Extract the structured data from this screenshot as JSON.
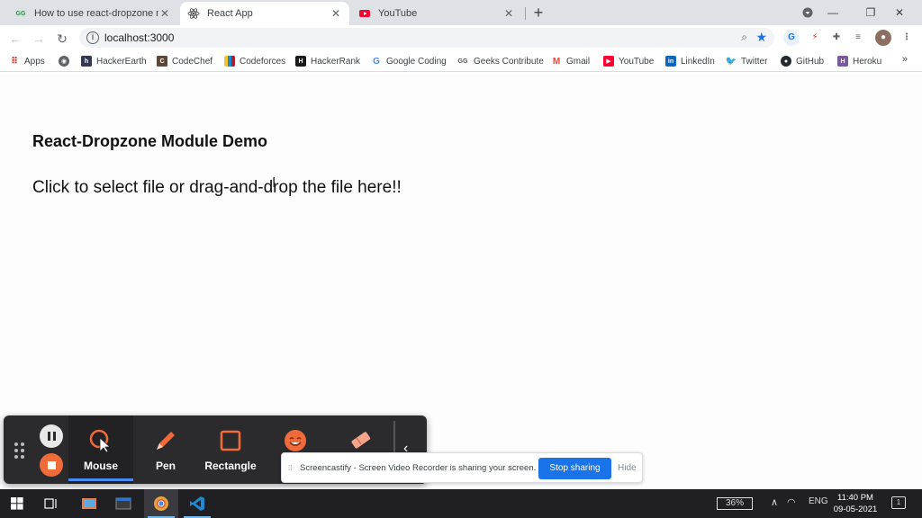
{
  "browser": {
    "tabs": [
      {
        "title": "How to use react-dropzone mod",
        "favicon": "gfg-icon"
      },
      {
        "title": "React App",
        "favicon": "react-icon"
      },
      {
        "title": "YouTube",
        "favicon": "youtube-icon"
      }
    ],
    "active_tab": 1,
    "url": "localhost:3000",
    "bookmarks": [
      {
        "label": "Apps"
      },
      {
        "label": ""
      },
      {
        "label": "HackerEarth"
      },
      {
        "label": "CodeChef"
      },
      {
        "label": "Codeforces"
      },
      {
        "label": "HackerRank"
      },
      {
        "label": "Google Coding"
      },
      {
        "label": "Geeks Contribute"
      },
      {
        "label": "Gmail"
      },
      {
        "label": "YouTube"
      },
      {
        "label": "LinkedIn"
      },
      {
        "label": "Twitter"
      },
      {
        "label": "GitHub"
      },
      {
        "label": "Heroku"
      }
    ],
    "bookmarks_more": "»"
  },
  "page": {
    "heading": "React-Dropzone Module Demo",
    "dropzone_text": "Click to select file or drag-and-drop the file here!!"
  },
  "screencastify": {
    "tools": [
      {
        "label": "Mouse"
      },
      {
        "label": "Pen"
      },
      {
        "label": "Rectangle"
      },
      {
        "label": "S"
      },
      {
        "label": ""
      }
    ],
    "active_tool": "Mouse",
    "share_message": "Screencastify - Screen Video Recorder is sharing your screen.",
    "stop_label": "Stop sharing",
    "hide_label": "Hide",
    "accent": "#f06b3a"
  },
  "taskbar": {
    "battery": "36%",
    "language": "ENG",
    "time": "11:40 PM",
    "date": "09-05-2021",
    "notifications": "1"
  }
}
